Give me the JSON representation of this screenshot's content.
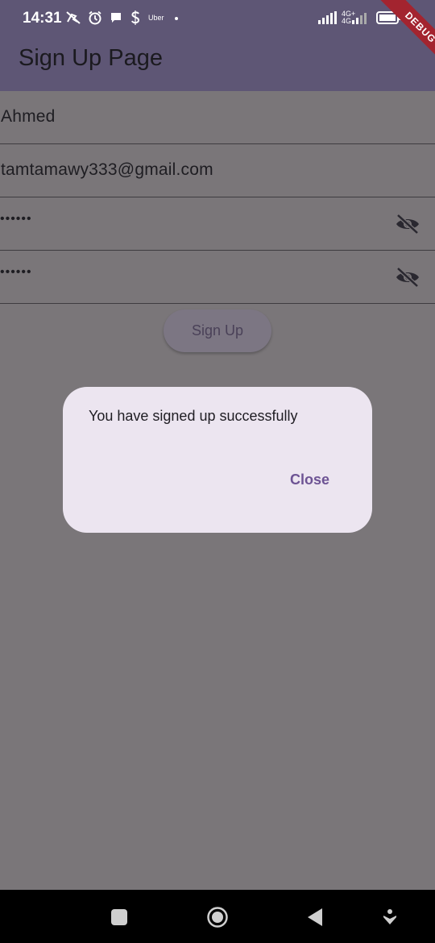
{
  "status_bar": {
    "time": "14:31",
    "uber_label": "Uber",
    "network_label_top": "4G+",
    "network_label_bottom": "4G",
    "debug_banner": "DEBUG"
  },
  "app_bar": {
    "title": "Sign Up Page"
  },
  "form": {
    "name_value": "Ahmed",
    "email_value": "tamtamawy333@gmail.com",
    "password_mask": "••••••",
    "confirm_password_mask": "••••••",
    "signup_label": "Sign Up"
  },
  "dialog": {
    "message": "You have signed up successfully",
    "close_label": "Close"
  },
  "nav_bar": {
    "icons": [
      "recents-icon",
      "home-icon",
      "back-icon",
      "accessibility-icon"
    ]
  },
  "colors": {
    "app_bar": "#5e5675",
    "scrim": "#7a7679",
    "dialog_bg": "#ece5f0",
    "accent": "#6d5394",
    "debug": "#a3242f"
  }
}
